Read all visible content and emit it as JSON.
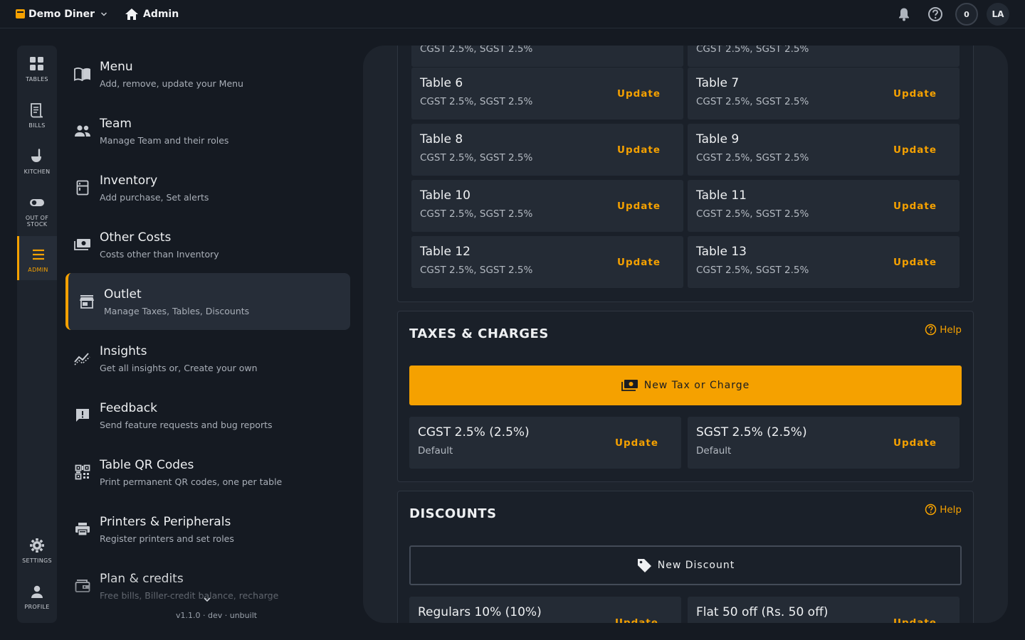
{
  "topbar": {
    "brand": "Demo Diner",
    "breadcrumb": "Admin",
    "notification_count": "0",
    "avatar_initials": "LA"
  },
  "rail": {
    "items": [
      {
        "label": "TABLES",
        "icon": "grid-icon"
      },
      {
        "label": "BILLS",
        "icon": "receipt-icon"
      },
      {
        "label": "KITCHEN",
        "icon": "ladle-icon"
      },
      {
        "label": "OUT OF STOCK",
        "icon": "toggle-icon"
      },
      {
        "label": "ADMIN",
        "icon": "hamburger-icon",
        "active": true
      },
      {
        "label": "SETTINGS",
        "icon": "gear-icon"
      },
      {
        "label": "PROFILE",
        "icon": "person-icon"
      }
    ]
  },
  "admin_menu": {
    "items": [
      {
        "title": "Menu",
        "subtitle": "Add, remove, update your Menu"
      },
      {
        "title": "Team",
        "subtitle": "Manage Team and their roles"
      },
      {
        "title": "Inventory",
        "subtitle": "Add purchase, Set alerts"
      },
      {
        "title": "Other Costs",
        "subtitle": "Costs other than Inventory"
      },
      {
        "title": "Outlet",
        "subtitle": "Manage Taxes, Tables, Discounts"
      },
      {
        "title": "Insights",
        "subtitle": "Get all insights or, Create your own"
      },
      {
        "title": "Feedback",
        "subtitle": "Send feature requests and bug reports"
      },
      {
        "title": "Table QR Codes",
        "subtitle": "Print permanent QR codes, one per table"
      },
      {
        "title": "Printers & Peripherals",
        "subtitle": "Register printers and set roles"
      },
      {
        "title": "Plan & credits",
        "subtitle": "Free bills, Biller-credit balance, recharge"
      }
    ],
    "version": "v1.1.0 · dev · unbuilt"
  },
  "tables": {
    "partial_sub_left": "CGST 2.5%, SGST 2.5%",
    "partial_sub_right": "CGST 2.5%, SGST 2.5%",
    "update_label": "Update",
    "items": [
      {
        "name": "Table 6",
        "taxes": "CGST 2.5%, SGST 2.5%"
      },
      {
        "name": "Table 7",
        "taxes": "CGST 2.5%, SGST 2.5%"
      },
      {
        "name": "Table 8",
        "taxes": "CGST 2.5%, SGST 2.5%"
      },
      {
        "name": "Table 9",
        "taxes": "CGST 2.5%, SGST 2.5%"
      },
      {
        "name": "Table 10",
        "taxes": "CGST 2.5%, SGST 2.5%"
      },
      {
        "name": "Table 11",
        "taxes": "CGST 2.5%, SGST 2.5%"
      },
      {
        "name": "Table 12",
        "taxes": "CGST 2.5%, SGST 2.5%"
      },
      {
        "name": "Table 13",
        "taxes": "CGST 2.5%, SGST 2.5%"
      }
    ]
  },
  "taxes": {
    "title": "TAXES & CHARGES",
    "help": "Help",
    "new_button": "New Tax or Charge",
    "items": [
      {
        "name": "CGST 2.5% (2.5%)",
        "sub": "Default",
        "action": "Update"
      },
      {
        "name": "SGST 2.5% (2.5%)",
        "sub": "Default",
        "action": "Update"
      }
    ]
  },
  "discounts": {
    "title": "DISCOUNTS",
    "help": "Help",
    "new_button": "New Discount",
    "items": [
      {
        "name": "Regulars 10% (10%)",
        "action": "Update"
      },
      {
        "name": "Flat 50 off (Rs. 50 off)",
        "action": "Update"
      }
    ]
  },
  "colors": {
    "accent": "#f5a100",
    "background": "#151a22",
    "panel": "#1e242d"
  }
}
